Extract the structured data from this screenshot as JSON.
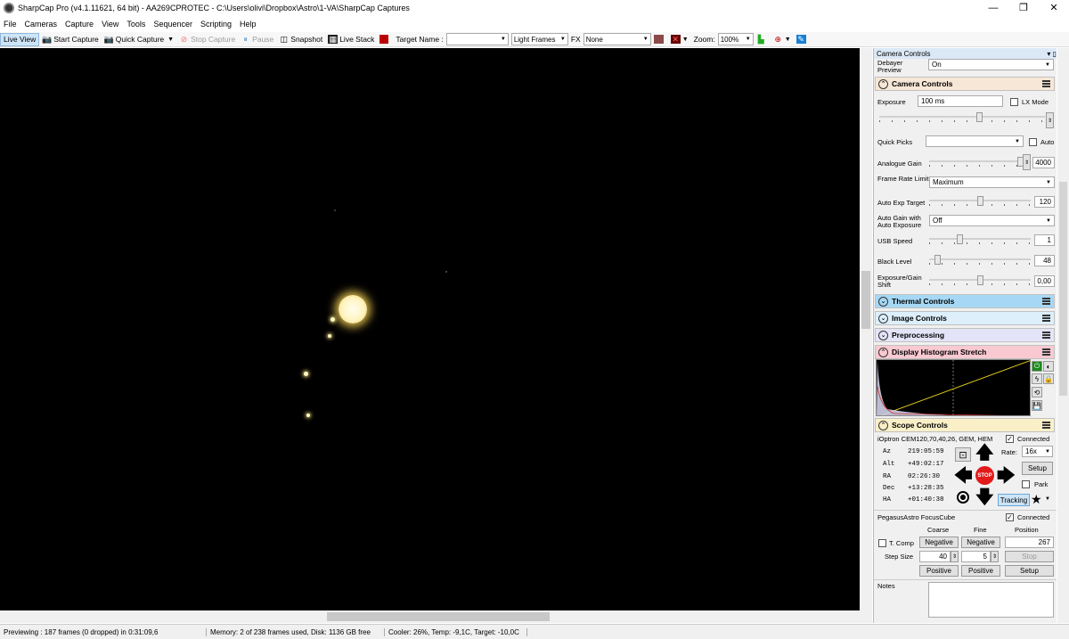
{
  "window": {
    "title": "SharpCap Pro (v4.1.11621, 64 bit) - AA269CPROTEC - C:\\Users\\olivi\\Dropbox\\Astro\\1-VA\\SharpCap Captures",
    "min": "—",
    "max": "❐",
    "close": "✕"
  },
  "menu": [
    "File",
    "Cameras",
    "Capture",
    "View",
    "Tools",
    "Sequencer",
    "Scripting",
    "Help"
  ],
  "toolbar": {
    "live_view": "Live View",
    "start_capture": "Start Capture",
    "quick_capture": "Quick Capture",
    "stop_capture": "Stop Capture",
    "pause": "Pause",
    "snapshot": "Snapshot",
    "live_stack": "Live Stack",
    "target_label": "Target Name :",
    "target_value": "",
    "frame_type": "Light Frames",
    "fx_label": "FX",
    "fx_value": "None",
    "zoom_label": "Zoom:",
    "zoom_value": "100%"
  },
  "panel": {
    "title": "Camera Controls",
    "pin": "▾ ▯",
    "debayer_label": "Debayer Preview",
    "debayer_value": "On",
    "camera_controls": "Camera Controls",
    "exposure_label": "Exposure",
    "exposure_value": "100 ms",
    "lx_mode": "LX Mode",
    "quick_picks": "Quick Picks",
    "auto": "Auto",
    "analogue_gain": "Analogue Gain",
    "analogue_gain_value": "4000",
    "analogue_gain_level": 0.98,
    "frame_rate_label": "Frame Rate Limit",
    "frame_rate_value": "Maximum",
    "auto_exp_label": "Auto Exp Target",
    "auto_exp_value": "120",
    "auto_exp_level": 0.5,
    "auto_gain_label": "Auto Gain with Auto Exposure",
    "auto_gain_value": "Off",
    "usb_label": "USB Speed",
    "usb_value": "1",
    "usb_level": 0.3,
    "black_label": "Black Level",
    "black_value": "48",
    "black_level": 0.08,
    "shift_label": "Exposure/Gain Shift",
    "shift_value": "0,00",
    "shift_level": 0.5,
    "exposure_level": 0.6,
    "thermal": "Thermal Controls",
    "image": "Image Controls",
    "preprocessing": "Preprocessing",
    "histogram": "Display Histogram Stretch",
    "scope": "Scope Controls",
    "mount_name": "iOptron CEM120,70,40,26, GEM, HEM",
    "connected": "Connected",
    "coords": [
      {
        "k": "Az",
        "v": "219:05:59"
      },
      {
        "k": "Alt",
        "v": "+49:02:17"
      },
      {
        "k": "RA",
        "v": "02:26:30"
      },
      {
        "k": "Dec",
        "v": "+13:28:35"
      },
      {
        "k": "HA",
        "v": "+01:40:38"
      }
    ],
    "rate_label": "Rate:",
    "rate_value": "16x",
    "setup": "Setup",
    "park": "Park",
    "stop": "STOP",
    "tracking": "Tracking",
    "focuser": "PegasusAstro FocusCube",
    "focuser_connected": "Connected",
    "coarse": "Coarse",
    "fine": "Fine",
    "position": "Position",
    "tcomp": "T. Comp",
    "negative": "Negative",
    "position_value": "267",
    "step_size": "Step Size",
    "coarse_step": "40",
    "fine_step": "5",
    "stop_btn": "Stop",
    "positive": "Positive",
    "setup2": "Setup",
    "notes": "Notes"
  },
  "status": {
    "preview": "Previewing : 187 frames (0 dropped) in 0:31:09,6",
    "memory": "Memory: 2 of 238 frames used, Disk: 1136 GB free",
    "cooler": "Cooler: 26%, Temp: -9,1C, Target: -10,0C"
  },
  "colors": {
    "thermal": "#a6d8f5",
    "image": "#dceffb",
    "preprocessing": "#e4e4f8",
    "histogram": "#f9c9d2",
    "scope": "#faf0c8",
    "camera": "#f7e7d6"
  }
}
